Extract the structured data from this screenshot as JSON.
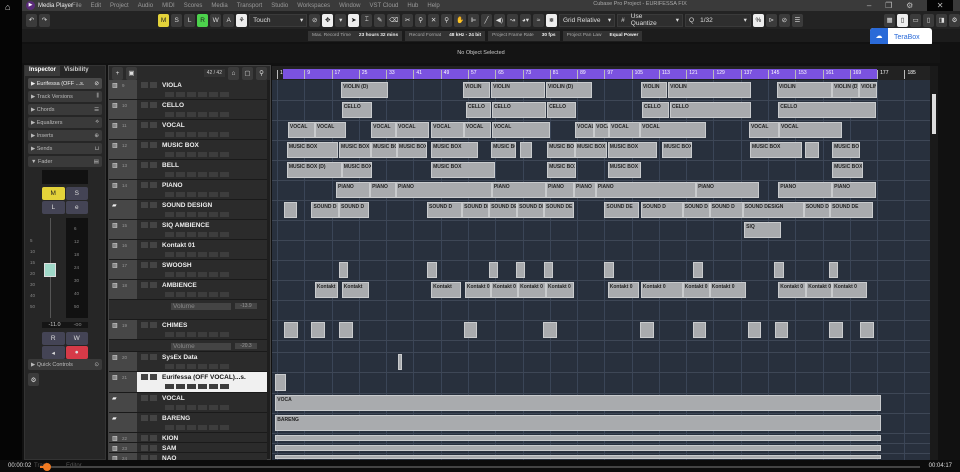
{
  "window": {
    "title": "Cubase Pro Project - EURIFESSA FIX",
    "media_player": "Media Player"
  },
  "menu": [
    "File",
    "Edit",
    "Project",
    "Audio",
    "MIDI",
    "Scores",
    "Media",
    "Transport",
    "Studio",
    "Workspaces",
    "Window",
    "VST Cloud",
    "Hub",
    "Help"
  ],
  "toolbar": {
    "states": [
      "M",
      "S",
      "L",
      "R",
      "W",
      "A"
    ],
    "automation_mode": "Touch",
    "snap_type": "Grid Relative",
    "quantize_mode": "Use Quantize",
    "quantize_value": "1/32"
  },
  "status": [
    {
      "label": "Max. Record Time",
      "value": "23 hours 32 mins"
    },
    {
      "label": "Record Format",
      "value": "48 kHz - 24 bit"
    },
    {
      "label": "Project Frame Rate",
      "value": "30 fps"
    },
    {
      "label": "Project Pan Law",
      "value": "Equal Power"
    }
  ],
  "info_line": "No Object Selected",
  "terabox": "TeraBox",
  "inspector": {
    "tabs": [
      "Inspector",
      "Visibility"
    ],
    "sections": [
      "Eurifessa (OFF ...s.",
      "Track Versions",
      "Chords",
      "Equalizers",
      "Inserts",
      "Sends",
      "Fader"
    ],
    "fader_buttons": [
      "M",
      "S",
      "L",
      "e"
    ],
    "scale": [
      "6",
      "12",
      "18",
      "24",
      "30",
      "40",
      "50"
    ],
    "fader_scale": [
      "5",
      "10",
      "15",
      "20",
      "30",
      "40",
      "50"
    ],
    "volume": "-11.0",
    "peak": "-oo",
    "rw": [
      "R",
      "W"
    ],
    "quick_controls": "Quick Controls"
  },
  "tracklist": {
    "count": "42 / 42"
  },
  "ruler": {
    "bars": [
      "1",
      "9",
      "17",
      "25",
      "33",
      "41",
      "49",
      "57",
      "65",
      "73",
      "81",
      "89",
      "97",
      "105",
      "113",
      "121",
      "129",
      "137",
      "145",
      "153",
      "161",
      "169",
      "177",
      "185"
    ],
    "range_start": 1,
    "range_end": 177
  },
  "tracks": [
    {
      "name": "VIOLA",
      "num": "9",
      "events": [
        [
          "VIOLIN (D)",
          19.8,
          33.6
        ],
        [
          "VIOLIN",
          55.5,
          63.5
        ],
        [
          "VIOLIN",
          63.8,
          79.6
        ],
        [
          "VIOLIN (D)",
          79.9,
          93.4
        ],
        [
          "VIOLIN",
          107.7,
          115.4
        ],
        [
          "VIOLIN",
          115.7,
          140
        ],
        [
          "VIOLIN",
          147.6,
          163.8
        ],
        [
          "VIOLIN (D)",
          163.8,
          171.7
        ],
        [
          "VIOLIN",
          171.7,
          177
        ]
      ]
    },
    {
      "name": "CELLO",
      "num": "10",
      "events": [
        [
          "CELLO",
          20,
          28.9
        ],
        [
          "CELLO",
          56.4,
          63.8
        ],
        [
          "CELLO",
          64,
          79.9
        ],
        [
          "CELLO",
          80.2,
          88.7
        ],
        [
          "CELLO",
          108,
          116
        ],
        [
          "CELLO",
          116.2,
          140
        ],
        [
          "CELLO",
          148,
          176.6
        ]
      ]
    },
    {
      "name": "VOCAL",
      "num": "11",
      "events": [
        [
          "VOCAL",
          4.2,
          12.1
        ],
        [
          "VOCAL",
          12.1,
          21.2
        ],
        [
          "VOCAL",
          28.6,
          35.9
        ],
        [
          "VOCAL",
          35.9,
          45.6
        ],
        [
          "VOCAL",
          46.2,
          55.8
        ],
        [
          "VOCAL",
          55.8,
          63.8
        ],
        [
          "VOCAL",
          64,
          81
        ],
        [
          "VOCAL",
          88.4,
          94
        ],
        [
          "VOCAL",
          94,
          98.4
        ],
        [
          "VOCAL",
          98.4,
          107.5
        ],
        [
          "VOCAL",
          107.5,
          126.8
        ],
        [
          "VOCAL",
          139.4,
          148.2
        ],
        [
          "VOCAL",
          148.2,
          166.7
        ]
      ]
    },
    {
      "name": "MUSIC BOX",
      "num": "12",
      "events": [
        [
          "MUSIC BOX",
          3.9,
          18.9
        ],
        [
          "MUSIC BOX",
          19.2,
          28.6
        ],
        [
          "MUSIC BOX",
          28.6,
          36.2
        ],
        [
          "MUSIC BOX",
          36.2,
          45
        ],
        [
          "MUSIC BOX",
          46.2,
          60
        ],
        [
          "MUSIC BOX",
          63.8,
          71.1
        ],
        [
          "",
          72.3,
          75.8
        ],
        [
          "MUSIC BOX",
          80.2,
          88.4
        ],
        [
          "MUSIC BOX",
          88.4,
          97.8
        ],
        [
          "MUSIC BOX",
          98,
          112.4
        ],
        [
          "MUSIC BOX",
          113.9,
          122.7
        ],
        [
          "MUSIC BOX",
          139.7,
          154.9
        ],
        [
          "",
          155.8,
          159.9
        ],
        [
          "MUSIC BOX",
          163.8,
          172
        ]
      ]
    },
    {
      "name": "BELL",
      "num": "13",
      "events": [
        [
          "MUSIC BOX (D)",
          3.9,
          20
        ],
        [
          "MUSIC BOX",
          20,
          28.9
        ],
        [
          "MUSIC BOX",
          46.2,
          64.9
        ],
        [
          "MUSIC BOX",
          80.2,
          88.7
        ],
        [
          "MUSIC BOX",
          98,
          107.7
        ],
        [
          "MUSIC BOX",
          163.8,
          172.8
        ]
      ]
    },
    {
      "name": "PIANO",
      "num": "14",
      "events": [
        [
          "PIANO",
          18.3,
          28.3
        ],
        [
          "PIANO",
          28.3,
          35.9
        ],
        [
          "PIANO",
          35.9,
          64
        ],
        [
          "PIANO",
          64,
          79.9
        ],
        [
          "PIANO",
          79.9,
          88.1
        ],
        [
          "PIANO",
          88.1,
          94.5
        ],
        [
          "PIANO",
          94.5,
          123.9
        ],
        [
          "PIANO",
          123.9,
          142.3
        ],
        [
          "PIANO",
          148,
          163.8
        ],
        [
          "PIANO",
          163.8,
          176.6
        ]
      ]
    },
    {
      "name": "SOUND DESIGN",
      "num": "",
      "folder": true,
      "events": [
        [
          "",
          3,
          6.9
        ],
        [
          "SOUND D",
          11.1,
          19.2
        ],
        [
          "SOUND D",
          19.2,
          28
        ],
        [
          "SOUND D",
          45,
          55.3
        ],
        [
          "SOUND DE",
          55.3,
          63.2
        ],
        [
          "SOUND DE",
          63.2,
          71.4
        ],
        [
          "SOUND DE",
          71.4,
          79.3
        ],
        [
          "SOUND DE",
          79.3,
          88.1
        ],
        [
          "SOUND DE",
          97,
          107.2
        ],
        [
          "SOUND D",
          107.7,
          120
        ],
        [
          "SOUND D",
          120,
          127.9
        ],
        [
          "SOUND D",
          127.9,
          137.6
        ],
        [
          "SOUND DESIGN",
          137.6,
          155.5
        ],
        [
          "SOUND D",
          155.5,
          163.2
        ],
        [
          "SOUND DE",
          163.2,
          175.8
        ]
      ]
    },
    {
      "name": "SIQ AMBIENCE",
      "num": "15",
      "events": [
        [
          "SIQ",
          138,
          148.8
        ]
      ]
    },
    {
      "name": "Kontakt 01",
      "num": "16",
      "events": []
    },
    {
      "name": "SWOOSH",
      "num": "17",
      "events": [
        [
          "",
          19.2,
          21.8
        ],
        [
          "",
          45,
          47.9
        ],
        [
          "",
          63.2,
          65.8
        ],
        [
          "",
          71.1,
          73.7
        ],
        [
          "",
          79.3,
          81.9
        ],
        [
          "",
          97,
          99.8
        ],
        [
          "",
          123,
          126
        ],
        [
          "",
          146.7,
          149.7
        ],
        [
          "",
          162.9,
          165.5
        ]
      ]
    },
    {
      "name": "AMBIENCE",
      "num": "18",
      "events": [
        [
          "Kontakt",
          12.1,
          18.9
        ],
        [
          "Kontakt",
          20,
          28
        ],
        [
          "Kontakt",
          46.2,
          55
        ],
        [
          "Kontakt 0",
          56.1,
          63.8
        ],
        [
          "Kontakt 0",
          63.8,
          71.7
        ],
        [
          "Kontakt 0",
          71.7,
          79.9
        ],
        [
          "Kontakt 0",
          79.9,
          88.1
        ],
        [
          "Kontakt 0",
          98,
          107.2
        ],
        [
          "Kontakt 0",
          107.7,
          120
        ],
        [
          "Kontakt 0",
          120,
          127.9
        ],
        [
          "Kontakt 0",
          127.9,
          138.5
        ],
        [
          "Kontakt 0",
          148,
          156.2
        ],
        [
          "Kontakt 0",
          156.2,
          163.8
        ],
        [
          "Kontakt 0",
          163.8,
          174
        ]
      ]
    },
    {
      "name": "Volume",
      "value": "-13.9",
      "lane": true,
      "events": []
    },
    {
      "name": "CHIMES",
      "num": "19",
      "events": [
        [
          "",
          3,
          7.1
        ],
        [
          "",
          11,
          15.1
        ],
        [
          "",
          19.2,
          23.3
        ],
        [
          "",
          55.8,
          59.7
        ],
        [
          "",
          79,
          83
        ],
        [
          "",
          107.5,
          111.6
        ],
        [
          "",
          123,
          126.8
        ],
        [
          "",
          139,
          142.8
        ],
        [
          "",
          146.9,
          151
        ],
        [
          "",
          162.9,
          167
        ],
        [
          "",
          172,
          176
        ]
      ]
    },
    {
      "name": "Volume",
      "value": "-20.3",
      "lane": true,
      "events": []
    },
    {
      "name": "SysEx Data",
      "num": "20",
      "events": [
        [
          "",
          36.5,
          37.3
        ]
      ]
    },
    {
      "name": "Eurifessa (OFF VOCAL)...s.",
      "num": "21",
      "selected": true,
      "events": [
        [
          "",
          0.5,
          3.6
        ]
      ]
    },
    {
      "name": "VOCAL",
      "num": "",
      "folder": true,
      "events": [
        [
          "VOCA",
          0.5,
          178
        ]
      ]
    },
    {
      "name": "BARENG",
      "num": "",
      "folder": true,
      "events": [
        [
          "BARENG",
          0.5,
          178
        ]
      ]
    },
    {
      "name": "KION",
      "num": "22",
      "events": [
        [
          "",
          0.5,
          178
        ]
      ]
    },
    {
      "name": "SAM",
      "num": "23",
      "events": [
        [
          "",
          0.5,
          178
        ]
      ]
    },
    {
      "name": "NAO",
      "num": "24",
      "events": [
        [
          "",
          0.5,
          178
        ]
      ]
    }
  ],
  "player": {
    "elapsed": "00:00:02",
    "total": "00:04:17",
    "progress": 0.008,
    "tabs": [
      "Track",
      "Editor"
    ]
  }
}
